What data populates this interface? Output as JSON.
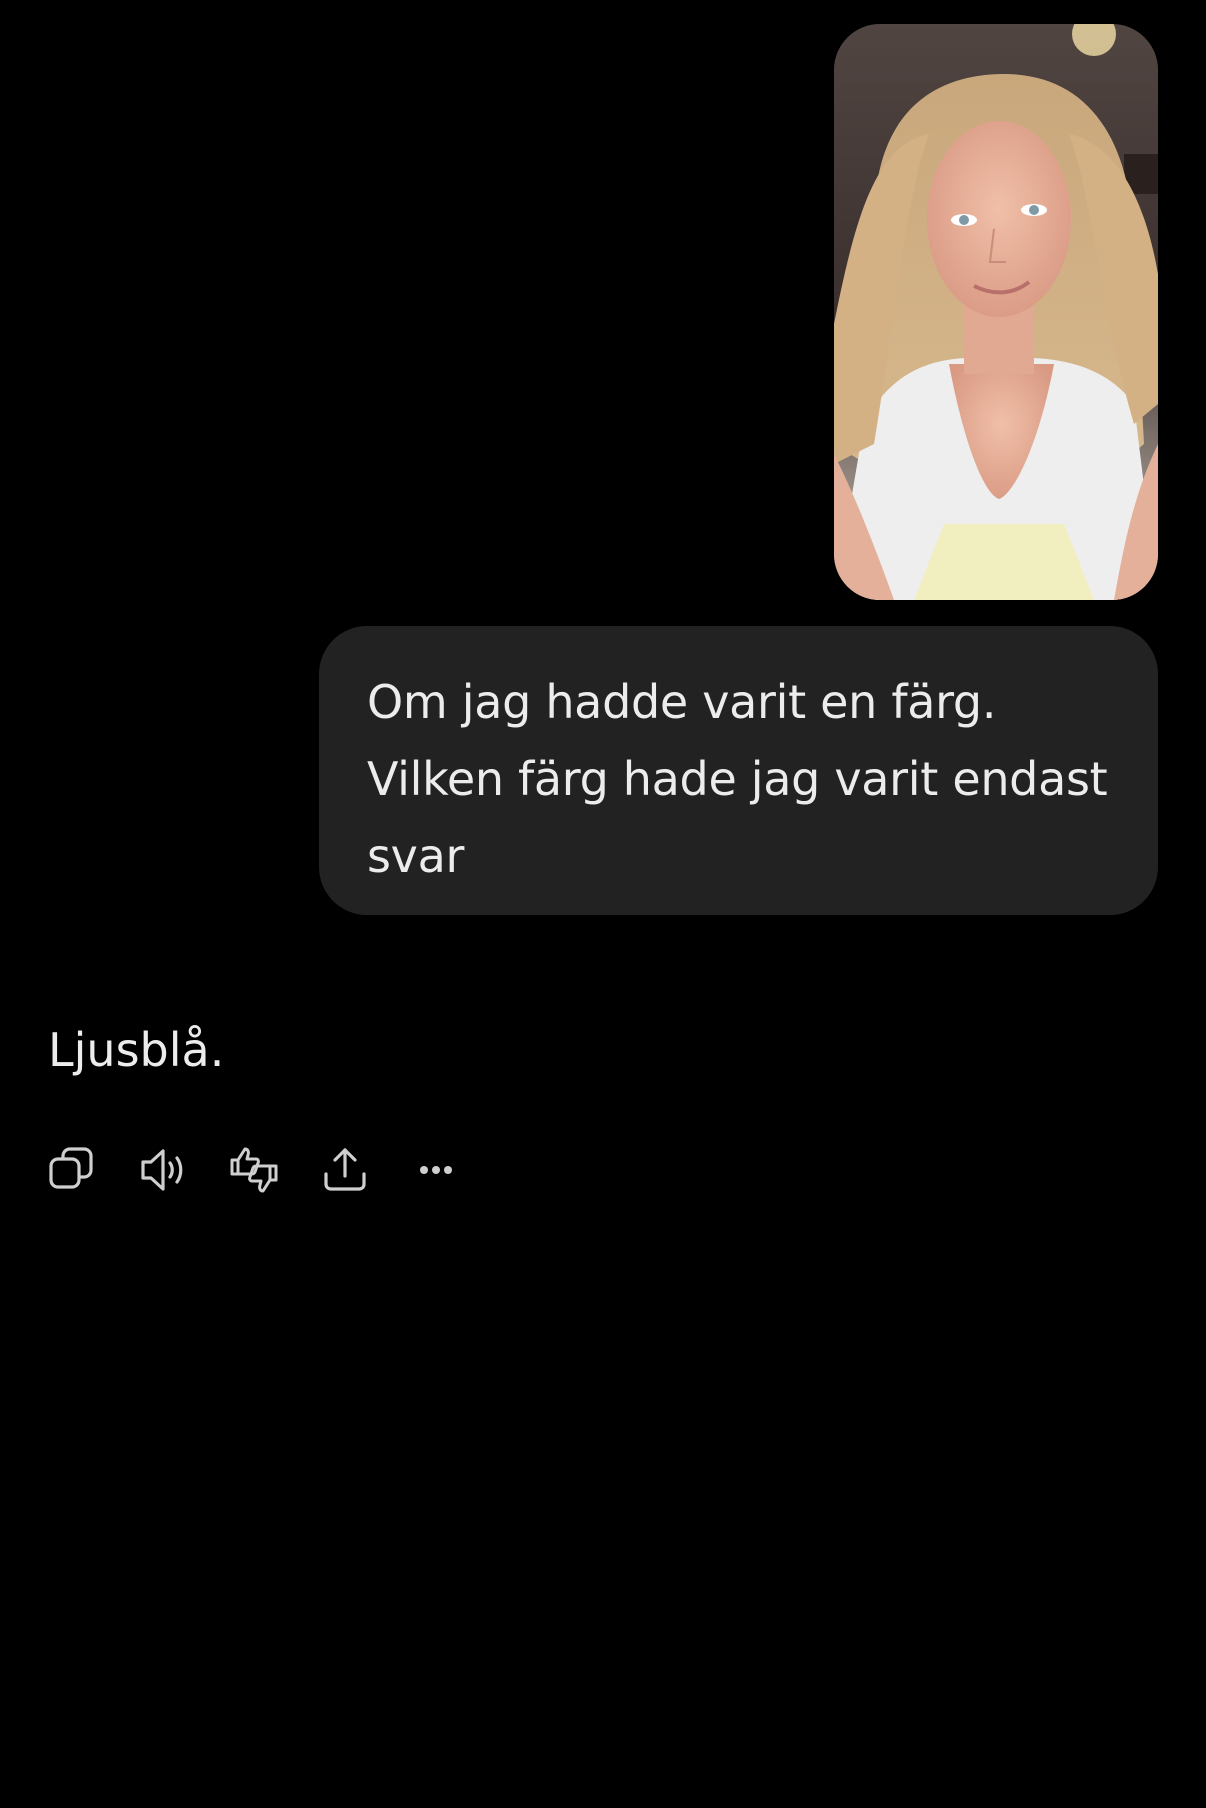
{
  "conversation": {
    "user_image": {
      "icon": "photo-of-person",
      "alt": ""
    },
    "user_message": "Om jag hadde varit en färg.\nVilken färg hade jag varit endast svar",
    "assistant_reply": "Ljusblå."
  },
  "actions": [
    {
      "name": "copy-button",
      "icon": "copy-icon"
    },
    {
      "name": "read-aloud-button",
      "icon": "speaker-icon"
    },
    {
      "name": "feedback-button",
      "icon": "thumbs-up-down-icon"
    },
    {
      "name": "share-button",
      "icon": "share-icon"
    },
    {
      "name": "more-button",
      "icon": "more-icon"
    }
  ],
  "colors": {
    "background": "#000000",
    "bubble": "#222222",
    "text": "#ececec",
    "icon": "#cfcfcf"
  }
}
